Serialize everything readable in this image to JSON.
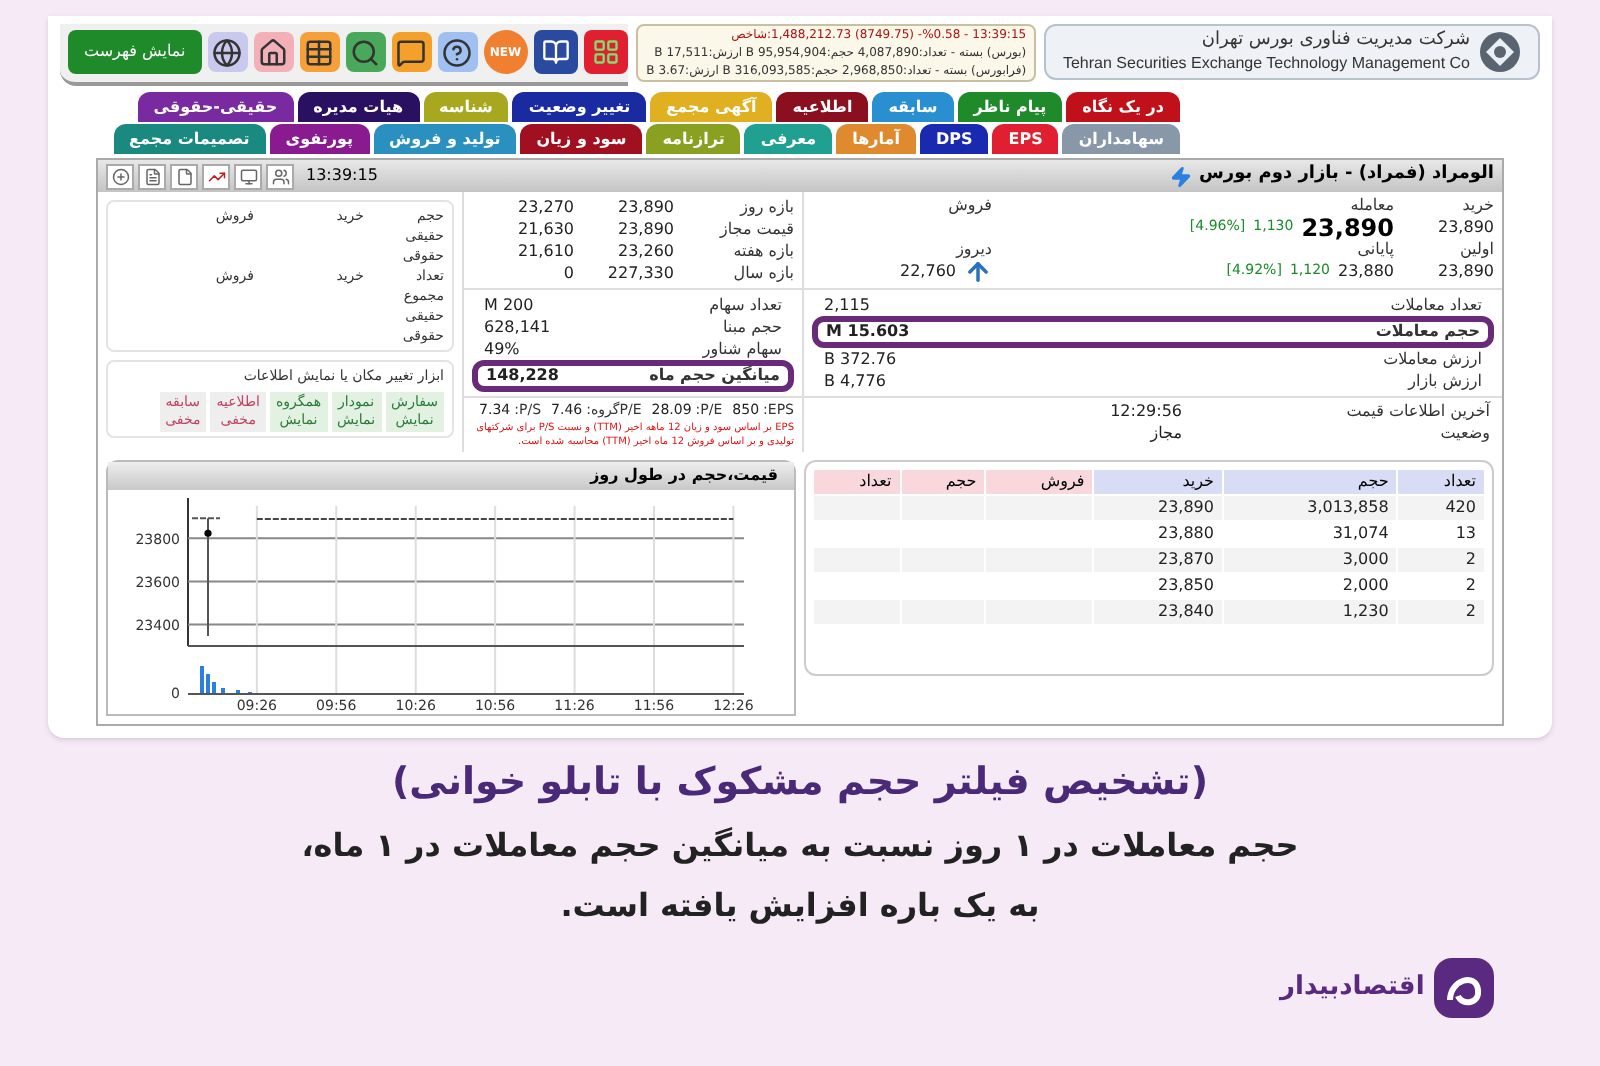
{
  "header": {
    "company_fa": "شرکت مدیریت فناوری بورس تهران",
    "company_en": "Tehran Securities Exchange Technology Management Co",
    "ticker": [
      "13:39:15 - %0.58- (8749.75) 1,488,212.73:شاخص",
      "(بورس) بسته - تعداد:4,087,890 حجم:95,954,904 B ارزش:17,511 B",
      "(فرابورس) بسته - تعداد:2,968,850 حجم:316,093,585 B ارزش:3.67 B"
    ],
    "menu_button": "نمایش فهرست",
    "new_badge": "NEW"
  },
  "tabs": [
    [
      {
        "label": "در یک نگاه",
        "color": "#c0101a"
      },
      {
        "label": "پیام ناظر",
        "color": "#1e8a2a"
      },
      {
        "label": "سابقه",
        "color": "#2a8fd0"
      },
      {
        "label": "اطلاعیه",
        "color": "#8a1020"
      },
      {
        "label": "آگهی مجمع",
        "color": "#e0b020"
      },
      {
        "label": "تغییر وضعیت",
        "color": "#1a2aa0"
      },
      {
        "label": "شناسه",
        "color": "#a8a820"
      },
      {
        "label": "هیات مدیره",
        "color": "#2a1060"
      },
      {
        "label": "حقیقی-حقوقی",
        "color": "#7a2aa0"
      }
    ],
    [
      {
        "label": "سهامداران",
        "color": "#8898a8"
      },
      {
        "label": "EPS",
        "color": "#e02030"
      },
      {
        "label": "DPS",
        "color": "#1a2ab0"
      },
      {
        "label": "آمارها",
        "color": "#e08a30"
      },
      {
        "label": "معرفی",
        "color": "#20a090"
      },
      {
        "label": "ترازنامه",
        "color": "#8aa020"
      },
      {
        "label": "سود و زیان",
        "color": "#a01020"
      },
      {
        "label": "تولید و فروش",
        "color": "#2a90c0"
      },
      {
        "label": "پورتفوی",
        "color": "#8a1a90"
      },
      {
        "label": "تصمیمات مجمع",
        "color": "#1a8a80"
      }
    ]
  ],
  "panel": {
    "title": "الومراد (فمراد) - بازار دوم بورس",
    "time": "13:39:15"
  },
  "quote": [
    {
      "kind": "plain",
      "label": "خرید",
      "value": "23,890"
    },
    {
      "kind": "main",
      "label": "معامله",
      "value": "23,890",
      "change": "1,130",
      "percent": "[4.96%]"
    },
    {
      "kind": "plain",
      "label": "فروش"
    },
    {
      "kind": "plain",
      "label": "اولین",
      "value": "23,890"
    },
    {
      "kind": "close",
      "label": "پایانی",
      "value": "23,880",
      "change": "1,120",
      "percent": "[4.92%]"
    },
    {
      "kind": "arrow",
      "label": "دیروز",
      "value": "22,760"
    }
  ],
  "ranges": [
    {
      "label": "بازه روز",
      "high": "23,890",
      "low": "23,270"
    },
    {
      "label": "قیمت مجاز",
      "high": "23,890",
      "low": "21,630"
    },
    {
      "label": "بازه هفته",
      "high": "23,260",
      "low": "21,610"
    },
    {
      "label": "بازه سال",
      "high": "227,330",
      "low": "0"
    }
  ],
  "trade_stats": [
    {
      "label": "تعداد معاملات",
      "value": "2,115",
      "highlighted": false
    },
    {
      "label": "حجم معاملات",
      "value": "15.603 M",
      "highlighted": true
    },
    {
      "label": "ارزش معاملات",
      "value": "372.76 B",
      "highlighted": false
    },
    {
      "label": "ارزش بازار",
      "value": "4,776 B",
      "highlighted": false
    }
  ],
  "share_stats": [
    {
      "label": "تعداد سهام",
      "value": "200 M",
      "highlighted": false
    },
    {
      "label": "حجم مبنا",
      "value": "628,141",
      "highlighted": false
    },
    {
      "label": "سهام شناور",
      "value": "49%",
      "highlighted": false
    },
    {
      "label": "میانگین حجم ماه",
      "value": "148,228",
      "highlighted": true
    }
  ],
  "last_info": [
    {
      "label": "آخرین اطلاعات قیمت",
      "value": "12:29:56"
    },
    {
      "label": "وضعیت",
      "value": "مجاز"
    }
  ],
  "ratios": [
    {
      "label": "EPS:",
      "value": "850"
    },
    {
      "label": "P/E:",
      "value": "28.09"
    },
    {
      "label": "P/Eگروه:",
      "value": "7.46"
    },
    {
      "label": "P/S:",
      "value": "7.34"
    }
  ],
  "ratio_note": "EPS بر اساس سود و زیان 12 ماهه اخیر (TTM) و نسبت P/S برای شرکتهای تولیدی و بر اساس فروش 12 ماه اخیر (TTM) محاسبه شده است.",
  "traders": [
    {
      "label": "حجم",
      "buy": "خرید",
      "sell": "فروش"
    },
    {
      "label": "حقیقی"
    },
    {
      "label": "حقوقی"
    },
    {
      "label": "تعداد",
      "buy": "خرید",
      "sell": "فروش"
    },
    {
      "label": "مجموع"
    },
    {
      "label": "حقیقی"
    },
    {
      "label": "حقوقی"
    }
  ],
  "tools": {
    "title": "ابزار تغییر مکان یا نمایش اطلاعات",
    "toggles": [
      {
        "label": "سفارش",
        "state": "نمایش",
        "on": true
      },
      {
        "label": "نمودار",
        "state": "نمایش",
        "on": true
      },
      {
        "label": "همگروه",
        "state": "نمایش",
        "on": true
      },
      {
        "label": "اطلاعیه",
        "state": "مخفی",
        "on": false
      },
      {
        "label": "سابقه",
        "state": "مخفی",
        "on": false
      }
    ]
  },
  "chart": {
    "title": "قیمت،حجم در طول روز",
    "volume_tick": "0",
    "chart_data": {
      "type": "line",
      "x": [
        "09:26",
        "09:56",
        "10:26",
        "10:56",
        "11:26",
        "11:56",
        "12:26"
      ],
      "grid": true,
      "series": [
        {
          "color": "#444444",
          "line_style": "dashed",
          "values": [
            23890,
            23890,
            23890,
            23890,
            23890,
            23890,
            23890
          ]
        }
      ],
      "ylim": [
        23300,
        23950
      ],
      "yticks": [
        {
          "value": 23400,
          "label": "23400"
        },
        {
          "value": 23600,
          "label": "23600"
        },
        {
          "value": 23800,
          "label": "23800"
        }
      ]
    }
  },
  "orders": {
    "columns": [
      {
        "label": "تعداد",
        "kind": "buy"
      },
      {
        "label": "حجم",
        "kind": "buy"
      },
      {
        "label": "خرید",
        "kind": "buy"
      },
      {
        "label": "فروش",
        "kind": "sell"
      },
      {
        "label": "حجم",
        "kind": "sell"
      },
      {
        "label": "تعداد",
        "kind": "sell"
      }
    ],
    "rows": [
      [
        "420",
        "3,013,858",
        "23,890"
      ],
      [
        "13",
        "31,074",
        "23,880"
      ],
      [
        "2",
        "3,000",
        "23,870"
      ],
      [
        "2",
        "2,000",
        "23,850"
      ],
      [
        "2",
        "1,230",
        "23,840"
      ]
    ]
  },
  "caption": {
    "title": "(تشخیص فیلتر حجم مشکوک با تابلو خوانی)",
    "lines": [
      "حجم معاملات در ۱ روز نسبت به میانگین حجم معاملات در ۱ ماه،",
      "به یک باره افزایش یافته است."
    ],
    "brand": "اقتصادبیدار"
  }
}
